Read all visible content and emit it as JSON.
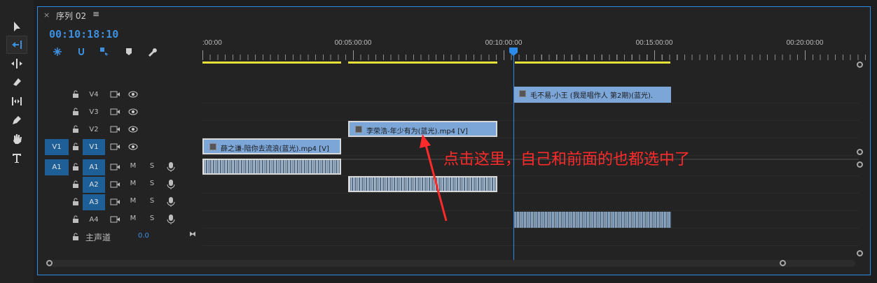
{
  "tab": {
    "close": "×",
    "title": "序列 02",
    "menu": "≡"
  },
  "timecode": "00:10:18:10",
  "ruler_labels": [
    ":00:00",
    "00:05:00:00",
    "00:10:00:00",
    "00:15:00:00",
    "00:20:00:00"
  ],
  "tracks": {
    "video": [
      {
        "name": "V4",
        "source": "",
        "target_on": false
      },
      {
        "name": "V3",
        "source": "",
        "target_on": false
      },
      {
        "name": "V2",
        "source": "",
        "target_on": false
      },
      {
        "name": "V1",
        "source": "V1",
        "target_on": true
      }
    ],
    "audio": [
      {
        "name": "A1",
        "source": "A1",
        "target_on": true,
        "m": "M",
        "s": "S"
      },
      {
        "name": "A2",
        "source": "",
        "target_on": true,
        "m": "M",
        "s": "S"
      },
      {
        "name": "A3",
        "source": "",
        "target_on": true,
        "m": "M",
        "s": "S"
      },
      {
        "name": "A4",
        "source": "",
        "target_on": false,
        "m": "M",
        "s": "S"
      }
    ],
    "master": {
      "label": "主声道",
      "value": "0.0"
    }
  },
  "clips": {
    "v4": "毛不易-小王 (我是唱作人 第2期)(蓝光).",
    "v2": "李荣浩-年少有为(蓝光).mp4 [V]",
    "v1": "薛之谦-陪你去流浪(蓝光).mp4 [V]"
  },
  "annotation": "点击这里，自己和前面的也都选中了",
  "colors": {
    "accent": "#2d8ceb",
    "clip_video": "#7ca6d8",
    "workbar": "#e8e03a",
    "annotation": "#ff2a2a",
    "target": "#1d5f96"
  }
}
